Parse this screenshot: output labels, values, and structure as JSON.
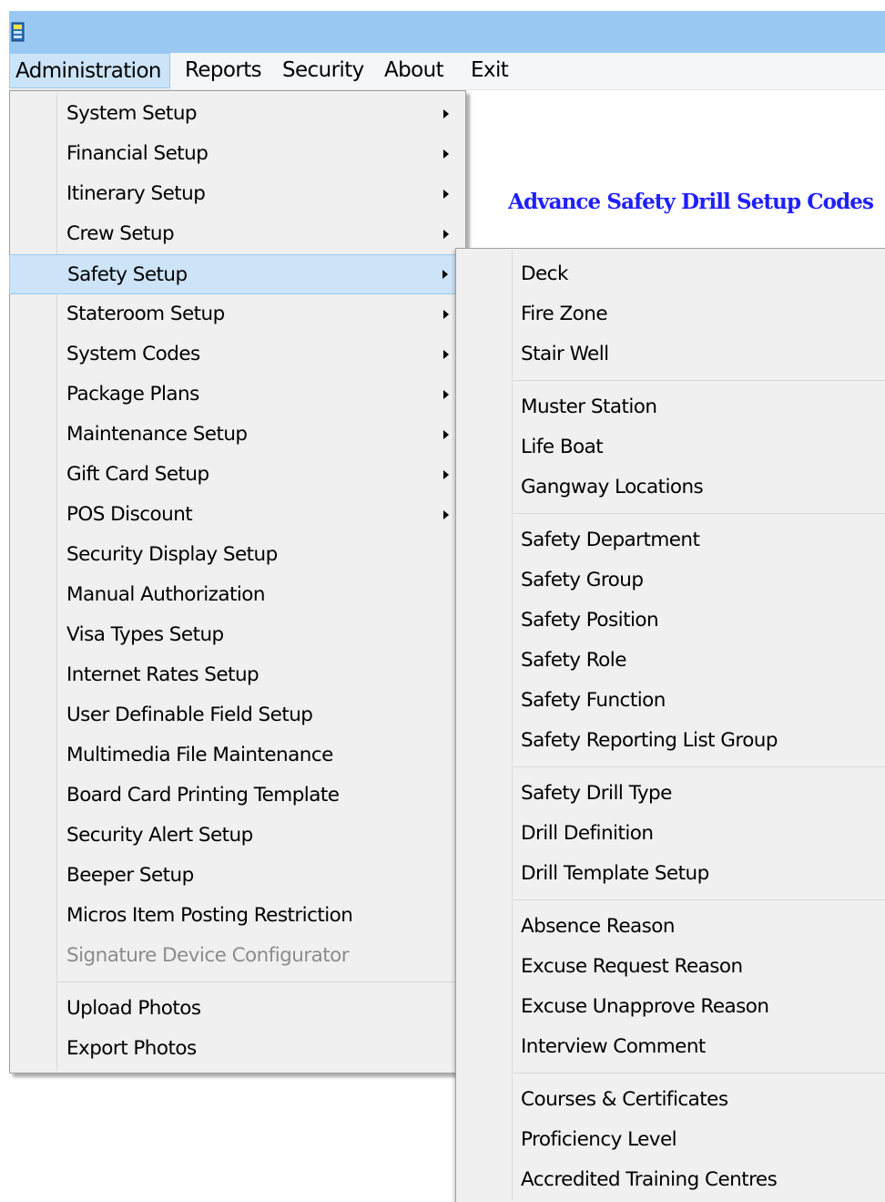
{
  "menubar": {
    "items": [
      {
        "label": "Administration"
      },
      {
        "label": "Reports"
      },
      {
        "label": "Security"
      },
      {
        "label": "About"
      },
      {
        "label": "Exit"
      }
    ]
  },
  "page_heading": "Advance Safety Drill Setup Codes",
  "admin_menu": {
    "items": [
      {
        "label": "System Setup",
        "submenu": true
      },
      {
        "label": "Financial Setup",
        "submenu": true
      },
      {
        "label": "Itinerary Setup",
        "submenu": true
      },
      {
        "label": "Crew Setup",
        "submenu": true
      },
      {
        "label": "Safety Setup",
        "submenu": true,
        "highlighted": true
      },
      {
        "label": "Stateroom Setup",
        "submenu": true
      },
      {
        "label": "System Codes",
        "submenu": true
      },
      {
        "label": "Package Plans",
        "submenu": true
      },
      {
        "label": "Maintenance Setup",
        "submenu": true
      },
      {
        "label": "Gift Card Setup",
        "submenu": true
      },
      {
        "label": "POS Discount",
        "submenu": true
      },
      {
        "label": "Security Display Setup"
      },
      {
        "label": "Manual Authorization"
      },
      {
        "label": "Visa Types Setup"
      },
      {
        "label": "Internet Rates Setup"
      },
      {
        "label": "User Definable Field Setup"
      },
      {
        "label": "Multimedia File Maintenance"
      },
      {
        "label": "Board Card Printing Template"
      },
      {
        "label": "Security Alert Setup"
      },
      {
        "label": "Beeper Setup"
      },
      {
        "label": "Micros Item Posting Restriction"
      },
      {
        "label": "Signature Device Configurator",
        "disabled": true
      },
      {
        "label": "Upload Photos"
      },
      {
        "label": "Export Photos"
      }
    ]
  },
  "safety_submenu": {
    "items": [
      {
        "label": "Deck"
      },
      {
        "label": "Fire Zone"
      },
      {
        "label": "Stair Well"
      },
      {
        "label": "Muster Station"
      },
      {
        "label": "Life Boat"
      },
      {
        "label": "Gangway Locations"
      },
      {
        "label": "Safety Department"
      },
      {
        "label": "Safety Group"
      },
      {
        "label": "Safety Position"
      },
      {
        "label": "Safety Role"
      },
      {
        "label": "Safety Function"
      },
      {
        "label": "Safety Reporting List Group"
      },
      {
        "label": "Safety Drill Type"
      },
      {
        "label": "Drill Definition"
      },
      {
        "label": "Drill Template Setup"
      },
      {
        "label": "Absence Reason"
      },
      {
        "label": "Excuse Request Reason"
      },
      {
        "label": "Excuse Unapprove Reason"
      },
      {
        "label": "Interview Comment"
      },
      {
        "label": "Courses & Certificates"
      },
      {
        "label": "Proficiency Level"
      },
      {
        "label": "Accredited Training Centres"
      }
    ]
  },
  "colors": {
    "titlebar": "#99c9f3",
    "menu_background": "#f0f0f0",
    "highlight": "#cde3f7",
    "heading": "#1f1fff"
  },
  "icons": {
    "app": "app-window-icon",
    "submenu": "submenu-arrow-icon"
  }
}
